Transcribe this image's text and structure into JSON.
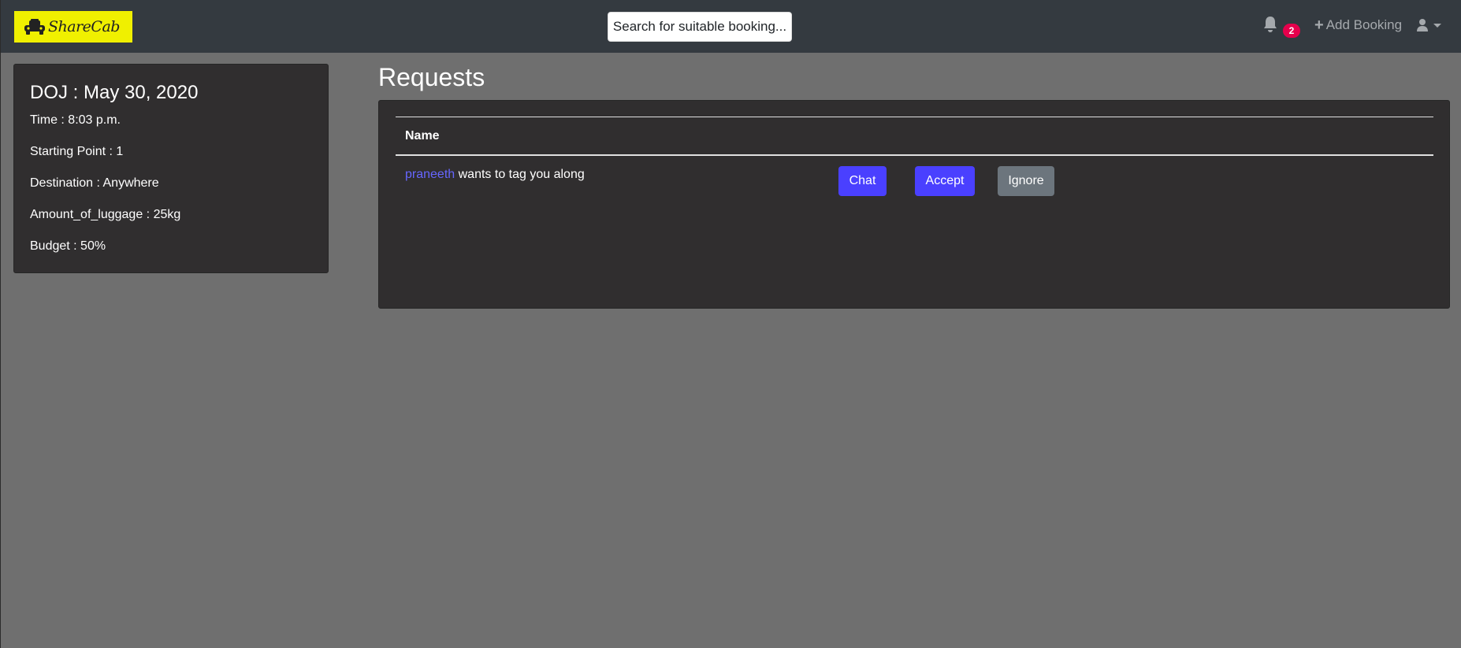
{
  "navbar": {
    "brand_name": "ShareCab",
    "search_button_label": "Search for suitable booking...",
    "notification_count": "2",
    "add_booking_label": "Add Booking",
    "icons": [
      "car-icon",
      "bell-icon",
      "plus-icon",
      "user-icon",
      "caret-down-icon"
    ],
    "brand_color": "#f0f000",
    "navbar_color": "#343a40"
  },
  "booking": {
    "doj": "DOJ : May 30, 2020",
    "time": "Time : 8:03 p.m.",
    "starting_point": "Starting Point : 1",
    "destination": "Destination : Anywhere",
    "luggage": "Amount_of_luggage : 25kg",
    "budget": "Budget : 50%"
  },
  "requests": {
    "title": "Requests",
    "column_header": "Name",
    "rows": [
      {
        "username": "praneeth",
        "message": "wants to tag you along",
        "chat_label": "Chat",
        "accept_label": "Accept",
        "ignore_label": "Ignore"
      }
    ],
    "colors": {
      "primary_button": "#4a40ff",
      "secondary_button": "#6c757d",
      "link": "#6666ff"
    }
  }
}
